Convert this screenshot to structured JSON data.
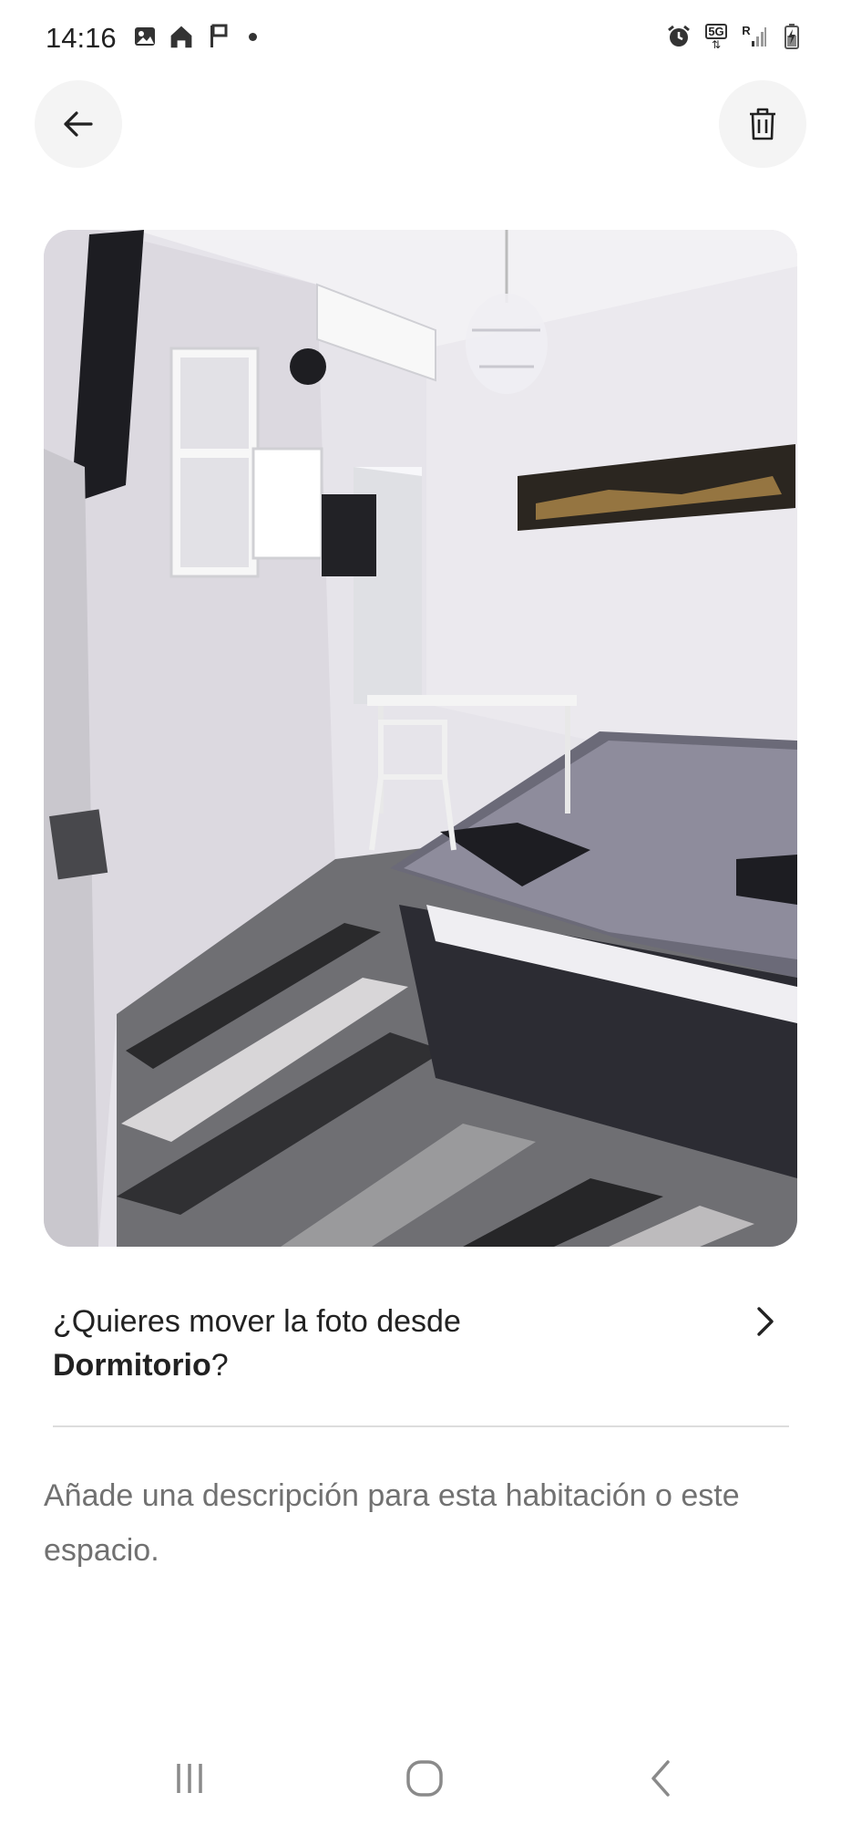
{
  "status_bar": {
    "time": "14:16",
    "left_icons": [
      "image-icon",
      "home-icon",
      "flag-icon",
      "notification-dot"
    ],
    "right_icons": [
      "alarm-icon",
      "5g-data-icon",
      "signal-icon",
      "battery-charging-icon"
    ],
    "network_label": "5G",
    "roaming_label": "R"
  },
  "header": {
    "back_icon": "arrow-left-icon",
    "delete_icon": "trash-icon"
  },
  "photo": {
    "subject": "bedroom"
  },
  "move_photo": {
    "question_prefix": "¿Quieres mover la foto desde",
    "room_name": "Dormitorio",
    "question_suffix": "?"
  },
  "description": {
    "placeholder": "Añade una descripción para esta habitación o este espacio."
  },
  "nav_bar": {
    "buttons": [
      "recents",
      "home",
      "back"
    ]
  },
  "colors": {
    "text_primary": "#222222",
    "text_secondary": "#717171",
    "button_bg": "#f4f4f4",
    "divider": "#dddddd"
  }
}
